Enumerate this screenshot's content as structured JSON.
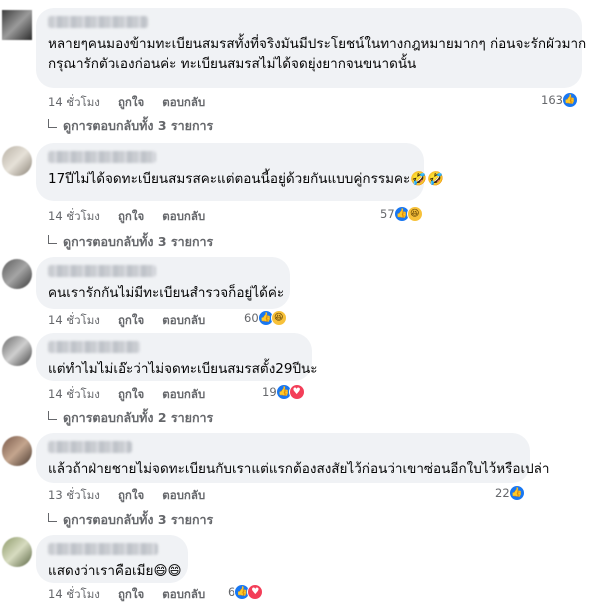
{
  "colors": {
    "like": "#1877f2",
    "haha": "#f7c13a",
    "love": "#f33e58",
    "bubble": "#f0f2f5",
    "meta": "#65676b"
  },
  "labels": {
    "like": "ถูกใจ",
    "reply": "ตอบกลับ"
  },
  "comments": [
    {
      "text_lines": [
        "หลายๆคนมองข้ามทะเบียนสมรสทั้งที่จริงมันมีประโยชน์ในทางกฎหมายมากๆ ก่อนจะรักผัวมาก",
        "กรุณารักตัวเองก่อนค่ะ ทะเบียนสมรสไม่ได้จดยุ่งยากจนขนาดนั้น"
      ],
      "time": "14 ชั่วโมง",
      "reaction_count": "163",
      "reactions": [
        "like-icon"
      ],
      "view_replies": "ดูการตอบกลับทั้ง 3 รายการ"
    },
    {
      "text_lines": [
        "17ปีไม่ได้จดทะเบียนสมรสคะแต่ตอนนี้อยู่ด้วยกันแบบคู่กรรมคะ🤣🤣"
      ],
      "time": "14 ชั่วโมง",
      "reaction_count": "57",
      "reactions": [
        "like-icon",
        "haha-icon"
      ],
      "view_replies": "ดูการตอบกลับทั้ง 3 รายการ"
    },
    {
      "text_lines": [
        "คนเรารักกันไม่มีทะเบียนสำรวจก็อยู่ได้ค่ะ"
      ],
      "time": "14 ชั่วโมง",
      "reaction_count": "60",
      "reactions": [
        "like-icon",
        "haha-icon"
      ],
      "view_replies": ""
    },
    {
      "text_lines": [
        "แต่ทำไมไม่เอ๊ะว่าไม่จดทะเบียนสมรสตั้ง29ปีนะ"
      ],
      "time": "14 ชั่วโมง",
      "reaction_count": "19",
      "reactions": [
        "like-icon",
        "love-icon"
      ],
      "view_replies": "ดูการตอบกลับทั้ง 2 รายการ"
    },
    {
      "text_lines": [
        "แล้วถ้าฝ่ายชายไม่จดทะเบียนกับเราแต่แรกต้องสงสัยไว้ก่อนว่าเขาซ่อนอีกใบไว้หรือเปล่า"
      ],
      "time": "13 ชั่วโมง",
      "reaction_count": "22",
      "reactions": [
        "like-icon"
      ],
      "view_replies": "ดูการตอบกลับทั้ง 3 รายการ"
    },
    {
      "text_lines": [
        "แสดงว่าเราคือเมีย😄😄"
      ],
      "time": "14 ชั่วโมง",
      "reaction_count": "6",
      "reactions": [
        "like-icon",
        "love-icon"
      ],
      "view_replies": ""
    }
  ]
}
